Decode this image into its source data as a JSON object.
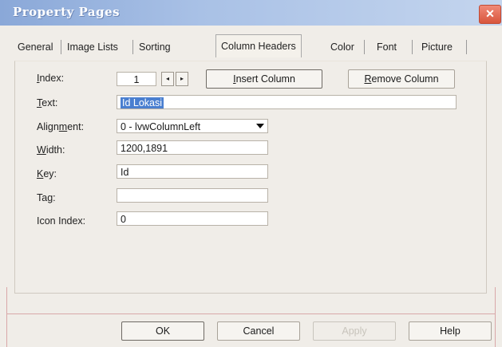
{
  "window": {
    "title": "Property Pages",
    "close_glyph": "✕"
  },
  "tabs": [
    {
      "label": "General"
    },
    {
      "label": "Image Lists"
    },
    {
      "label": "Sorting"
    },
    {
      "label": "Column Headers"
    },
    {
      "label": "Color"
    },
    {
      "label": "Font"
    },
    {
      "label": "Picture"
    }
  ],
  "form": {
    "index": {
      "label_pre": "",
      "label_ul": "I",
      "label_post": "ndex:",
      "value": "1"
    },
    "text": {
      "label_pre": "",
      "label_ul": "T",
      "label_post": "ext:",
      "value": "Id Lokasi"
    },
    "alignment": {
      "label_pre": "Align",
      "label_ul": "m",
      "label_post": "ent:",
      "value": "0 - lvwColumnLeft"
    },
    "width": {
      "label_pre": "",
      "label_ul": "W",
      "label_post": "idth:",
      "value": "1200,1891"
    },
    "key": {
      "label_pre": "",
      "label_ul": "K",
      "label_post": "ey:",
      "value": "Id"
    },
    "tag": {
      "label_pre": "Ta",
      "label_ul": "g",
      "label_post": ":",
      "value": ""
    },
    "icon_index": {
      "label": "Icon Index:",
      "value": "0"
    }
  },
  "buttons": {
    "insert_column": {
      "pre": "",
      "ul": "I",
      "post": "nsert Column"
    },
    "remove_column": {
      "pre": "",
      "ul": "R",
      "post": "emove Column"
    },
    "spin_left": "◂",
    "spin_right": "▸",
    "ok": "OK",
    "cancel": "Cancel",
    "apply": "Apply",
    "help": "Help"
  },
  "colors": {
    "title_bar": "#a9c1e6",
    "selection": "#4a7fd0",
    "close": "#d8553c"
  }
}
